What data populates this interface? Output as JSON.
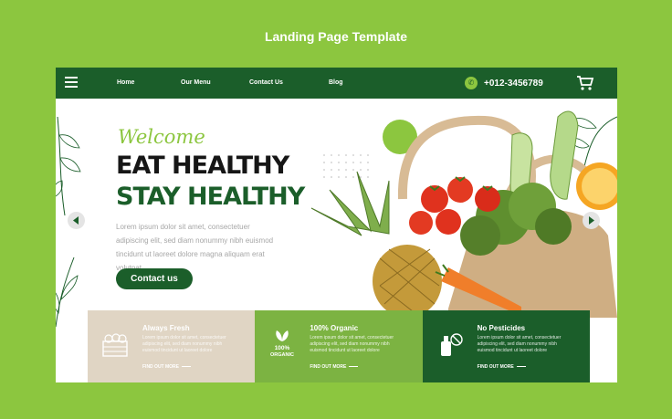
{
  "page_title": "Landing Page Template",
  "nav": {
    "links": [
      "Home",
      "Our Menu",
      "Contact Us",
      "Blog"
    ],
    "phone": "+012-3456789"
  },
  "hero": {
    "welcome": "Welcome",
    "headline_line1": "EAT HEALTHY",
    "headline_line2": "STAY HEALTHY",
    "description": "Lorem ipsum dolor sit amet, consectetuer adipiscing elit, sed diam nonummy nibh euismod tincidunt ut laoreet dolore magna aliquam erat volutpat.",
    "cta_label": "Contact us"
  },
  "features": [
    {
      "title": "Always Fresh",
      "text": "Lorem ipsum dolor sit amet, consectetuer adipiscing elit, sed diam nonummy nibh euismod tincidunt ut laoreet dolore",
      "link": "FIND OUT MORE",
      "icon": "crate-icon"
    },
    {
      "title": "100% Organic",
      "text": "Lorem ipsum dolor sit amet, consectetuer adipiscing elit, sed diam nonummy nibh euismod tincidunt ut laoreet dolore",
      "link": "FIND OUT MORE",
      "icon": "organic-badge-icon",
      "badge_line1": "100%",
      "badge_line2": "ORGANIC"
    },
    {
      "title": "No Pesticides",
      "text": "Lorem ipsum dolor sit amet, consectetuer adipiscing elit, sed diam nonummy nibh euismod tincidunt ut laoreet dolore",
      "link": "FIND OUT MORE",
      "icon": "no-pesticide-icon"
    }
  ],
  "colors": {
    "background": "#8cc63f",
    "dark_green": "#1b5e2a",
    "mid_green": "#7cb342",
    "beige": "#e0d5c4"
  }
}
